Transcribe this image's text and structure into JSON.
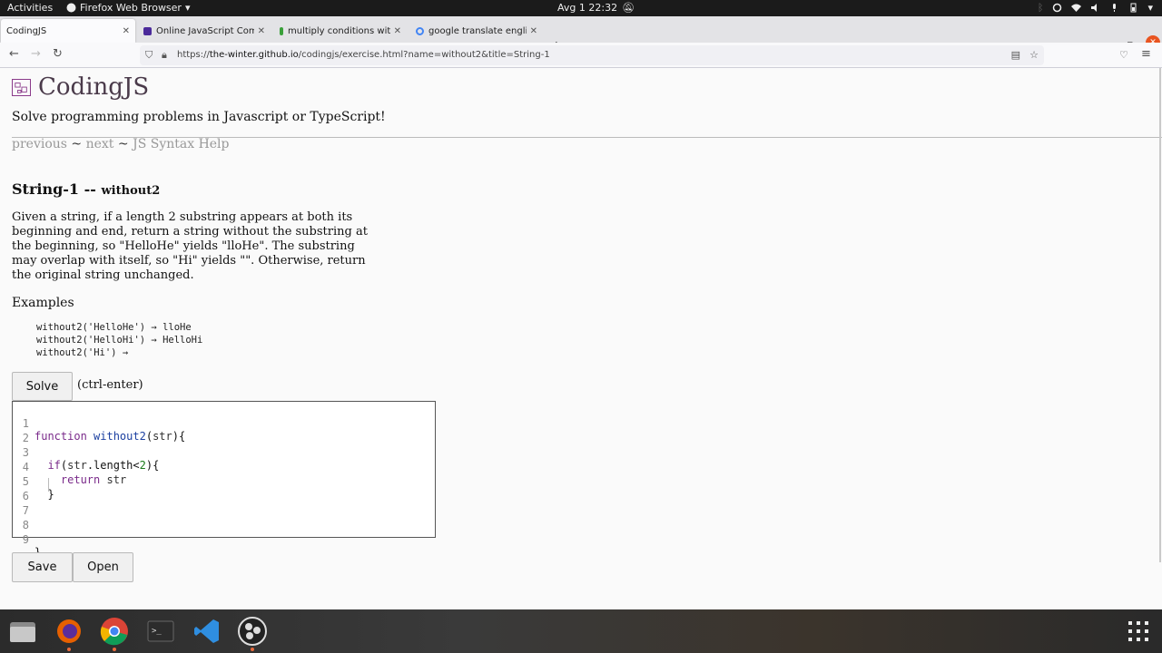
{
  "topbar": {
    "activities": "Activities",
    "app_name": "Firefox Web Browser",
    "clock": "Avg 1  22:32"
  },
  "tabs": [
    {
      "label": "CodingJS",
      "active": true
    },
    {
      "label": "Online JavaScript Compil",
      "active": false
    },
    {
      "label": "multiply conditions with",
      "active": false
    },
    {
      "label": "google translate english",
      "active": false
    }
  ],
  "url": {
    "prefix": "https://",
    "host": "the-winter.github.io",
    "path": "/codingjs/exercise.html?name=without2&title=String-1"
  },
  "page": {
    "site_title": "CodingJS",
    "subtitle": "Solve programming problems in Javascript or TypeScript!",
    "nav_prev": "previous",
    "nav_sep": "~",
    "nav_next": "next",
    "nav_help": "JS Syntax Help",
    "problem_category": "String-1 --",
    "problem_name": "without2",
    "description": "Given a string, if a length 2 substring appears at both its beginning and end, return a string without the substring at the beginning, so \"HelloHe\" yields \"lloHe\". The substring may overlap with itself, so \"Hi\" yields \"\". Otherwise, return the original string unchanged.",
    "examples_title": "Examples",
    "examples": [
      "without2('HelloHe') → lloHe",
      "without2('HelloHi') → HelloHi",
      "without2('Hi') →"
    ],
    "solve_label": "Solve",
    "solve_hint": "(ctrl-enter)",
    "save_label": "Save",
    "open_label": "Open"
  },
  "editor": {
    "line_numbers": [
      "1",
      "2",
      "3",
      "4",
      "5",
      "6",
      "7",
      "8",
      "9"
    ],
    "lines": [
      "function without2(str){",
      "",
      "  if(str.length<2){",
      "    return str",
      "  } ",
      "",
      "",
      "",
      "}"
    ]
  },
  "colors": {
    "accent_orange": "#e96a3c",
    "link_grey": "#999999",
    "keyword": "#7a2a8a"
  }
}
